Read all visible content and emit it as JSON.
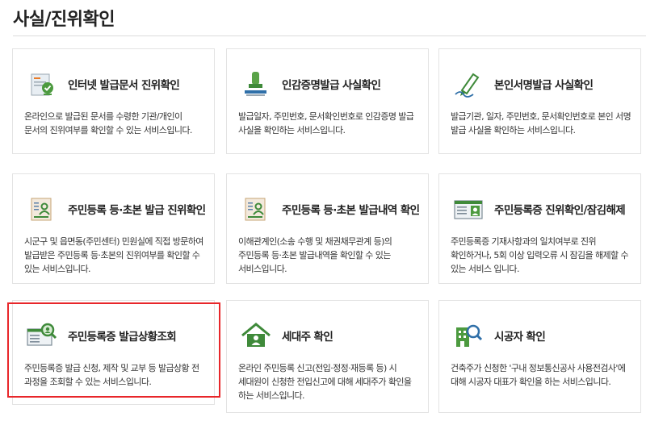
{
  "page": {
    "title": "사실/진위확인"
  },
  "accent_colors": {
    "green": "#3f8a3a",
    "highlight": "#e8262a"
  },
  "cards": [
    {
      "icon": "certificate-check-icon",
      "title": "인터넷 발급문서 진위확인",
      "desc": "온라인으로 발급된 문서를 수령한 기관/개인이 문서의 진위여부를 확인할 수 있는 서비스입니다."
    },
    {
      "icon": "seal-stamp-icon",
      "title": "인감증명발급 사실확인",
      "desc": "발급일자, 주민번호, 문서확인번호로 인감증명 발급 사실을 확인하는 서비스입니다."
    },
    {
      "icon": "signature-pen-icon",
      "title": "본인서명발급 사실확인",
      "desc": "발급기관, 일자, 주민번호, 문서확인번호로 본인 서명 발급 사실을 확인하는 서비스입니다."
    },
    {
      "icon": "resident-document-icon",
      "title": "주민등록 등·초본 발급 진위확인",
      "desc": "시군구 및 읍면동(주민센터) 민원실에 직접 방문하여 발급받은 주민등록 등·초본의 진위여부를 확인할 수 있는 서비스입니다."
    },
    {
      "icon": "resident-document-history-icon",
      "title": "주민등록 등·초본 발급내역 확인",
      "desc": "이해관계인(소송 수행 및 채권채무관계 등)의 주민등록 등·초본 발급내역을 확인할 수 있는 서비스입니다."
    },
    {
      "icon": "id-card-icon",
      "title": "주민등록증 진위확인/잠김해제",
      "desc": "주민등록증 기재사항과의 일치여부로 진위 확인하거나, 5회 이상 입력오류 시 잠김을 해제할 수 있는 서비스 입니다."
    },
    {
      "icon": "id-card-search-icon",
      "title": "주민등록증 발급상황조회",
      "desc": "주민등록증 발급 신청, 제작 및 교부 등 발급상황 전 과정을 조회할 수 있는 서비스입니다."
    },
    {
      "icon": "house-person-icon",
      "title": "세대주 확인",
      "desc": "온라인 주민등록 신고(전입·정정·재등록 등) 시 세대원이 신청한 전입신고에 대해 세대주가 확인을 하는 서비스입니다."
    },
    {
      "icon": "building-search-icon",
      "title": "시공자 확인",
      "desc": "건축주가 신청한 '구내 정보통신공사 사용전검사'에 대해 시공자 대표가 확인을 하는 서비스입니다."
    }
  ]
}
